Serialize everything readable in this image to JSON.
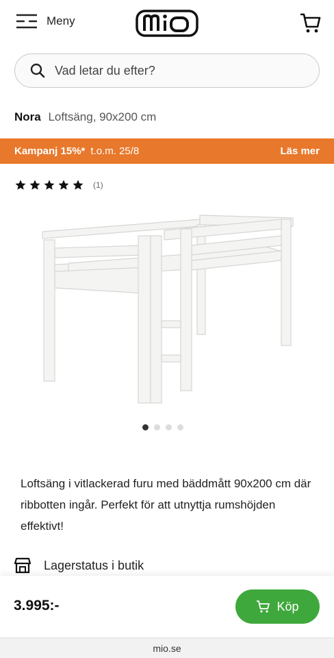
{
  "header": {
    "menu_label": "Meny",
    "logo_text": "mio"
  },
  "search": {
    "placeholder": "Vad letar du efter?"
  },
  "product": {
    "brand": "Nora",
    "subtitle": "Loftsäng, 90x200 cm",
    "rating_stars": 5,
    "rating_count": "(1)",
    "image_count": 4,
    "active_image": 1,
    "description": "Loftsäng i vitlackerad furu med bäddmått 90x200 cm där ribbotten ingår. Perfekt för att utnyttja rumshöjden effektivt!"
  },
  "campaign": {
    "label": "Kampanj 15%*",
    "date": "t.o.m. 25/8",
    "link": "Läs mer",
    "color": "#e8782b"
  },
  "stock": {
    "label": "Lagerstatus i butik",
    "icon": "store-icon"
  },
  "buy_bar": {
    "price": "3.995:-",
    "button_label": "Köp",
    "button_color": "#3fa83c"
  },
  "browser": {
    "url": "mio.se"
  }
}
